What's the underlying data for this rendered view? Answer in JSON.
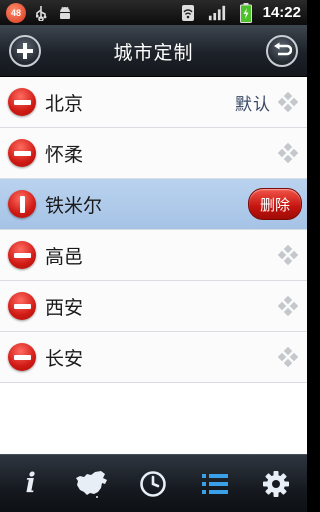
{
  "status_bar": {
    "notification_count": "48",
    "time": "14:22",
    "icons": [
      "usb-icon",
      "android-debug-icon",
      "wifi-icon",
      "signal-icon",
      "battery-charging-icon"
    ]
  },
  "header": {
    "title": "城市定制",
    "add_icon": "plus-icon",
    "back_icon": "undo-arrow-icon"
  },
  "cities": [
    {
      "name": "北京",
      "default_label": "默认",
      "selected": false
    },
    {
      "name": "怀柔",
      "default_label": "",
      "selected": false
    },
    {
      "name": "铁米尔",
      "default_label": "",
      "selected": true,
      "delete_label": "删除"
    },
    {
      "name": "高邑",
      "default_label": "",
      "selected": false
    },
    {
      "name": "西安",
      "default_label": "",
      "selected": false
    },
    {
      "name": "长安",
      "default_label": "",
      "selected": false
    }
  ],
  "bottom_tabs": [
    {
      "name": "info",
      "icon": "info-icon"
    },
    {
      "name": "map",
      "icon": "china-map-icon"
    },
    {
      "name": "clock",
      "icon": "clock-icon"
    },
    {
      "name": "list",
      "icon": "list-icon",
      "active": true
    },
    {
      "name": "settings",
      "icon": "gear-icon"
    }
  ],
  "colors": {
    "selected_row": "#a6c3e6",
    "delete_red": "#c3140e",
    "active_tab": "#3aa0e8"
  }
}
